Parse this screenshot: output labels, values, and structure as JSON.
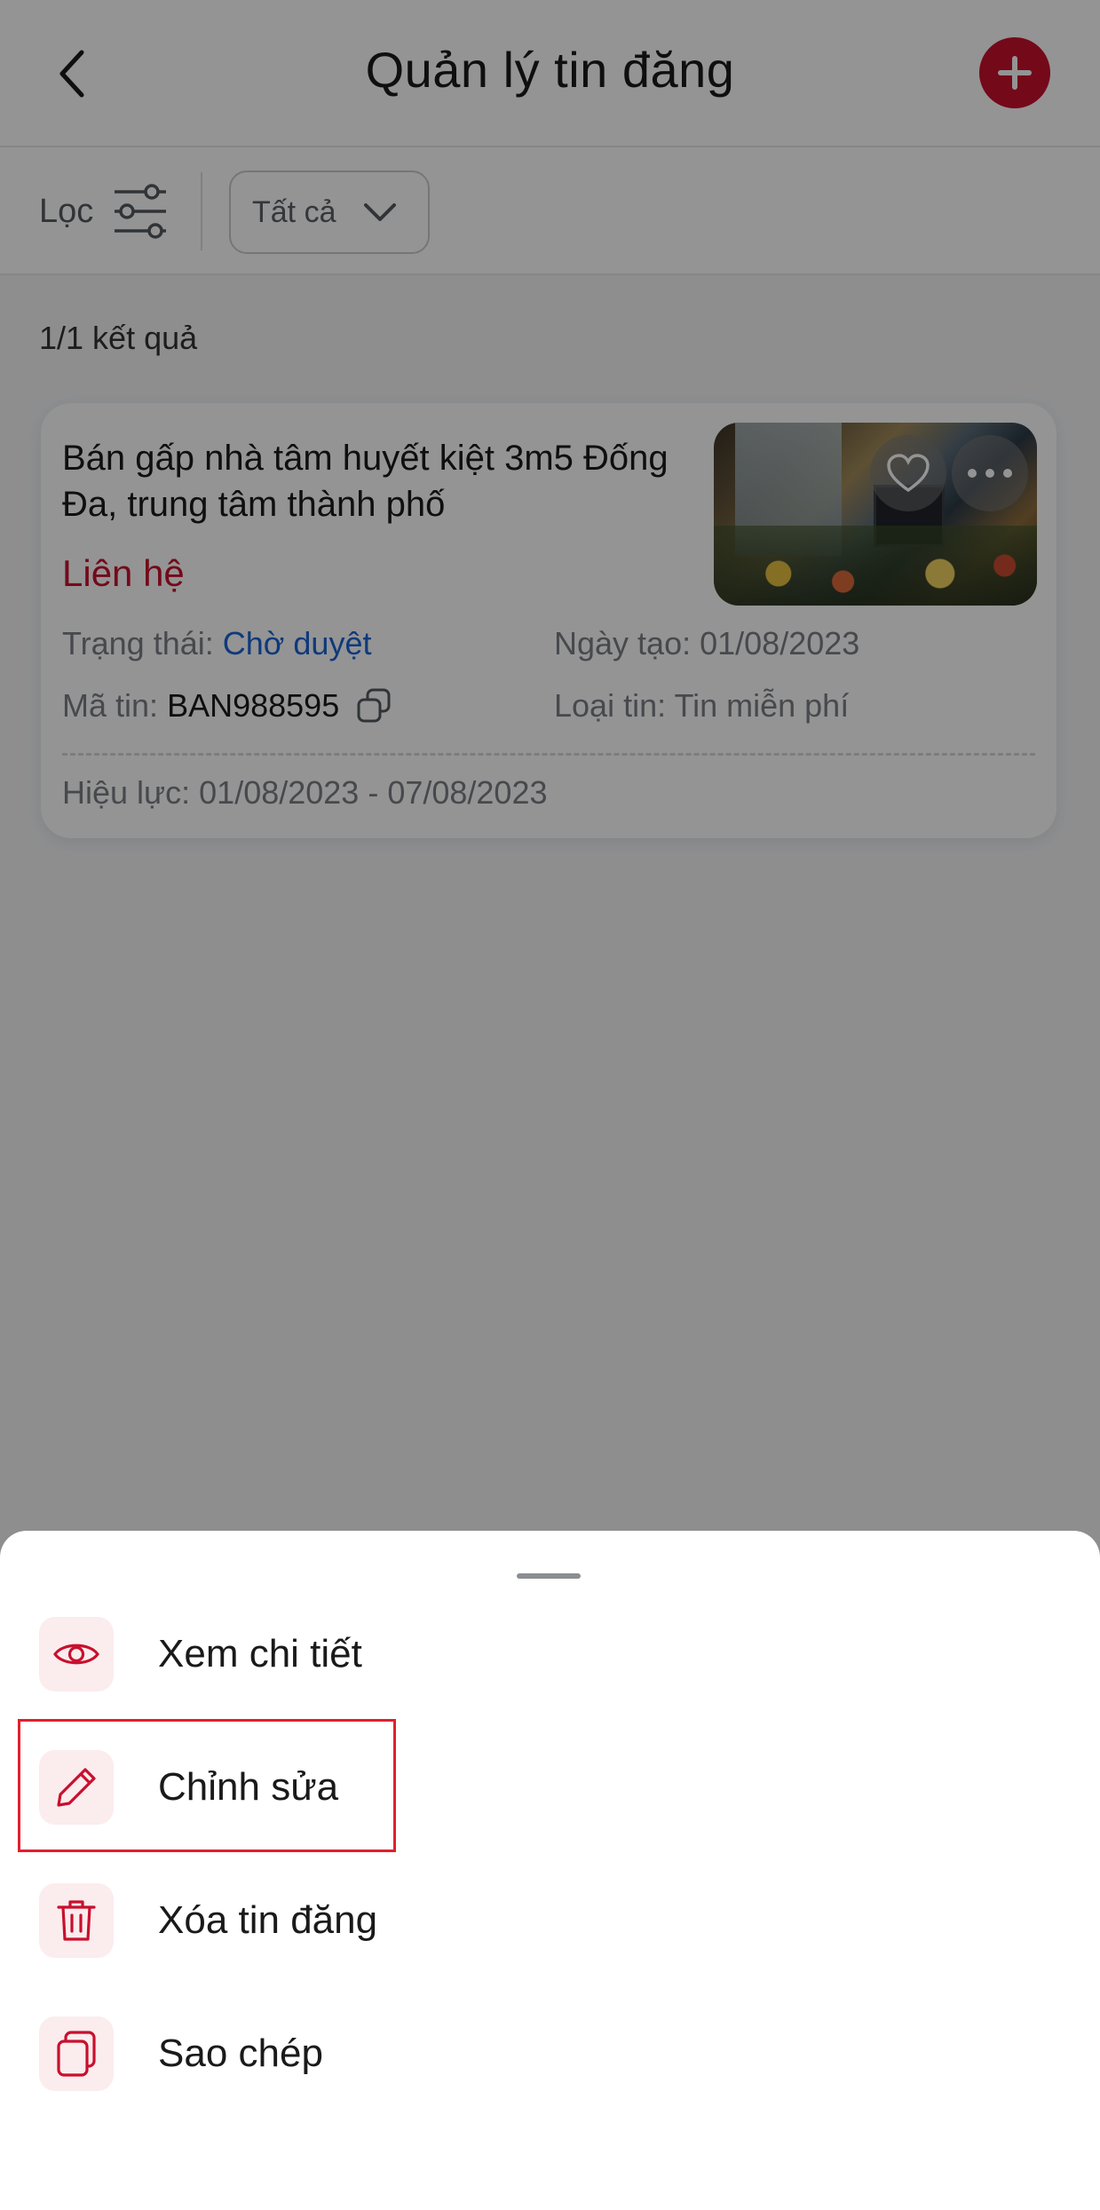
{
  "header": {
    "title": "Quản lý tin đăng",
    "back_icon": "chevron-left-icon",
    "add_icon": "plus-icon",
    "accent_color": "#c8102e"
  },
  "filter": {
    "label": "Lọc",
    "icon": "sliders-icon",
    "select_value": "Tất cả"
  },
  "results": {
    "count_text": "1/1 kết quả"
  },
  "listing": {
    "title": "Bán gấp nhà tâm huyết kiệt 3m5 Đống Đa, trung tâm thành phố",
    "price": "Liên hệ",
    "status_label": "Trạng thái:",
    "status_value": "Chờ duyệt",
    "created_label": "Ngày tạo:",
    "created_value": "01/08/2023",
    "code_label": "Mã tin:",
    "code_value": "BAN988595",
    "type_label": "Loại tin:",
    "type_value": "Tin miễn phí",
    "validity_label": "Hiệu lực:",
    "validity_value": "01/08/2023 - 07/08/2023",
    "status_color": "#1a63d6"
  },
  "sheet": {
    "actions": [
      {
        "label": "Xem chi tiết",
        "icon": "eye-icon"
      },
      {
        "label": "Chỉnh sửa",
        "icon": "pencil-icon"
      },
      {
        "label": "Xóa tin đăng",
        "icon": "trash-icon"
      },
      {
        "label": "Sao chép",
        "icon": "copy-icon"
      }
    ]
  }
}
